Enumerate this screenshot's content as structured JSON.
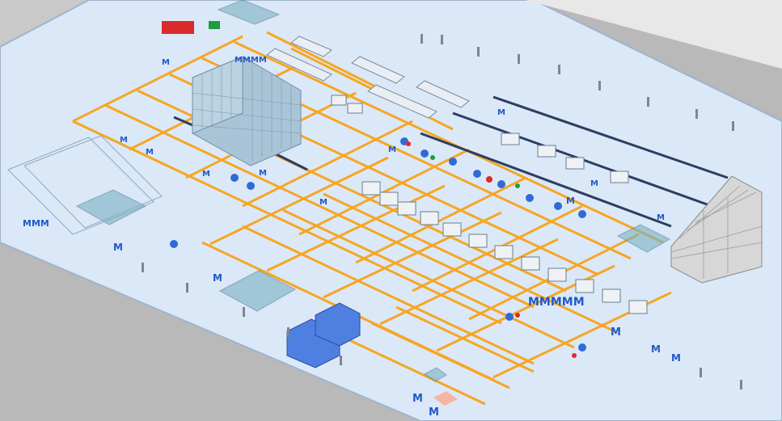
{
  "scene": {
    "title": "",
    "background_color": "#b9b9b9",
    "floor_color": "#dbe8f7",
    "floor_edge_color": "#9fb4cc",
    "conveyor_color": "#f6a623",
    "rack_color": "#a9c4d6",
    "storage_color": "#d7d7d7",
    "machine_color": "#2f6bd6",
    "badge_color": "#2159c9",
    "badge_letter": "M",
    "accent_red": "#d92b2b",
    "accent_green": "#1f9b43",
    "labels": {
      "m_row_1": "MMM",
      "m_row_2": "MMMM",
      "m_row_3": "MMMMM"
    }
  },
  "icons": {
    "badge": "m-badge-icon",
    "column": "support-column-icon",
    "forklift": "forklift-icon"
  }
}
